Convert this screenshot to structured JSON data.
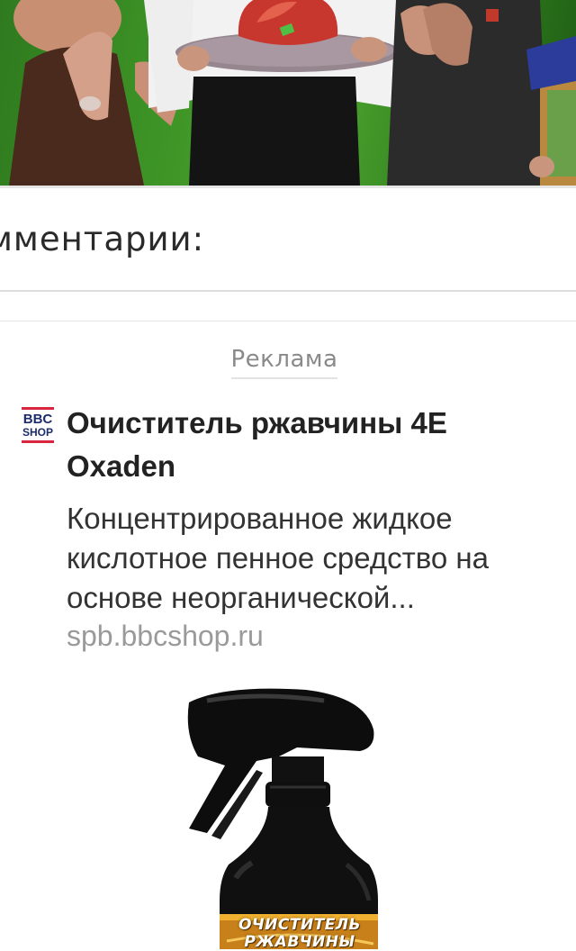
{
  "comments": {
    "title": "мментарии:"
  },
  "ad": {
    "label": "Реклама",
    "logo_top": "BBC",
    "logo_bottom": "SHOP",
    "title": "Очиститель ржавчины 4E Oxaden",
    "description": "Концентрированное жидкое кислотное пенное средство на основе неорганической...",
    "url": "spb.bbcshop.ru",
    "product_label_line1": "ОЧИСТИТЕЛЬ",
    "product_label_line2": "РЖАВЧИНЫ"
  },
  "colors": {
    "photo_background": "#3d9426",
    "logo_red": "#d7263d",
    "logo_navy": "#1c2d6b",
    "title_text": "#222222",
    "url_text": "#9a9a9a"
  }
}
